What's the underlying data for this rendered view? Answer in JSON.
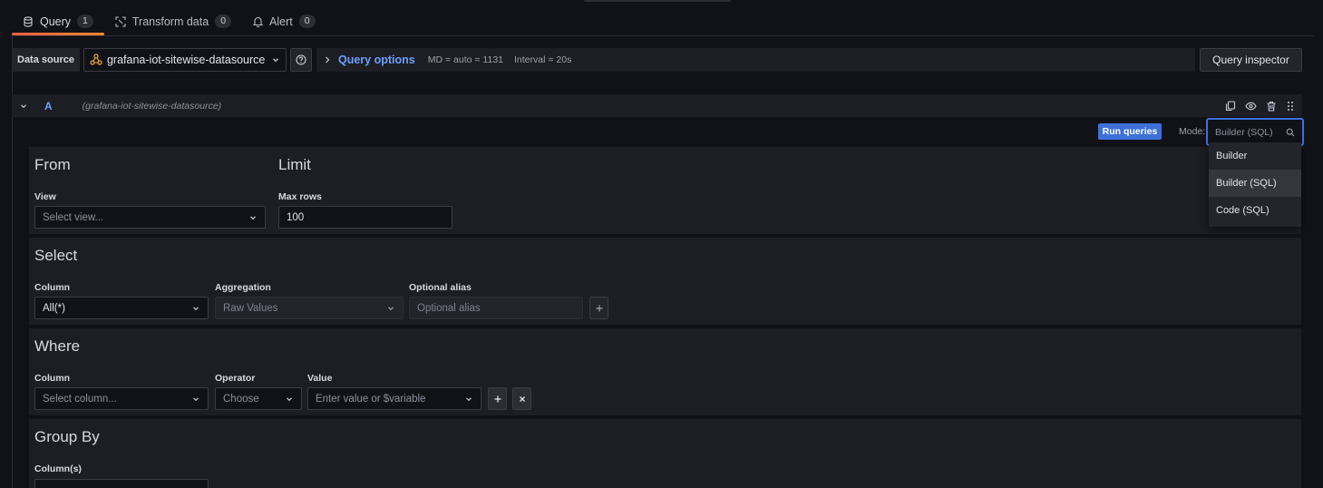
{
  "tabs": [
    {
      "label": "Query",
      "count": "1"
    },
    {
      "label": "Transform data",
      "count": "0"
    },
    {
      "label": "Alert",
      "count": "0"
    }
  ],
  "datasource": {
    "label": "Data source",
    "selected": "grafana-iot-sitewise-datasource"
  },
  "query_options": {
    "title": "Query options",
    "md": "MD = auto = 1131",
    "interval": "Interval = 20s"
  },
  "query_inspector_label": "Query inspector",
  "query": {
    "ref": "A",
    "datasource_name": "(grafana-iot-sitewise-datasource)"
  },
  "run_queries_label": "Run queries",
  "mode": {
    "label": "Mode:",
    "value": "Builder (SQL)",
    "options": [
      "Builder",
      "Builder (SQL)",
      "Code (SQL)"
    ]
  },
  "from": {
    "title": "From",
    "view_label": "View",
    "view_placeholder": "Select view..."
  },
  "limit": {
    "title": "Limit",
    "max_rows_label": "Max rows",
    "max_rows_value": "100"
  },
  "select": {
    "title": "Select",
    "column_label": "Column",
    "column_value": "All(*)",
    "aggregation_label": "Aggregation",
    "aggregation_value": "Raw Values",
    "alias_label": "Optional alias",
    "alias_placeholder": "Optional alias"
  },
  "where": {
    "title": "Where",
    "column_label": "Column",
    "column_placeholder": "Select column...",
    "operator_label": "Operator",
    "operator_placeholder": "Choose",
    "value_label": "Value",
    "value_placeholder": "Enter value or $variable"
  },
  "group_by": {
    "title": "Group By",
    "columns_label": "Column(s)"
  },
  "colors": {
    "accent": "#3d71d9",
    "link": "#6e9fff",
    "tab_active": "#f55f3e"
  }
}
